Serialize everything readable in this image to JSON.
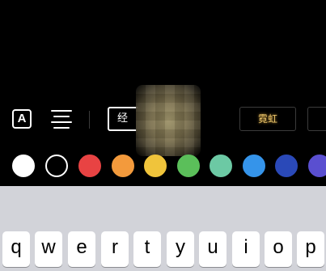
{
  "toolbar": {
    "text_style_icon": "A",
    "align_icon": "align-center-icon",
    "styles": [
      {
        "label": "经"
      },
      {
        "label": "霓虹"
      }
    ]
  },
  "swatches": [
    {
      "name": "white",
      "color": "#ffffff"
    },
    {
      "name": "black",
      "color": "#000000"
    },
    {
      "name": "red",
      "color": "#e84343"
    },
    {
      "name": "orange",
      "color": "#f39a3c"
    },
    {
      "name": "yellow",
      "color": "#f0c43b"
    },
    {
      "name": "green",
      "color": "#5bbf5a"
    },
    {
      "name": "teal",
      "color": "#6cc9a4"
    },
    {
      "name": "blue",
      "color": "#3594ea"
    },
    {
      "name": "navy",
      "color": "#2a49b8"
    },
    {
      "name": "purple",
      "color": "#5a4fd0"
    }
  ],
  "keyboard": {
    "row1": [
      "q",
      "w",
      "e",
      "r",
      "t",
      "y",
      "u",
      "i",
      "o",
      "p"
    ]
  }
}
